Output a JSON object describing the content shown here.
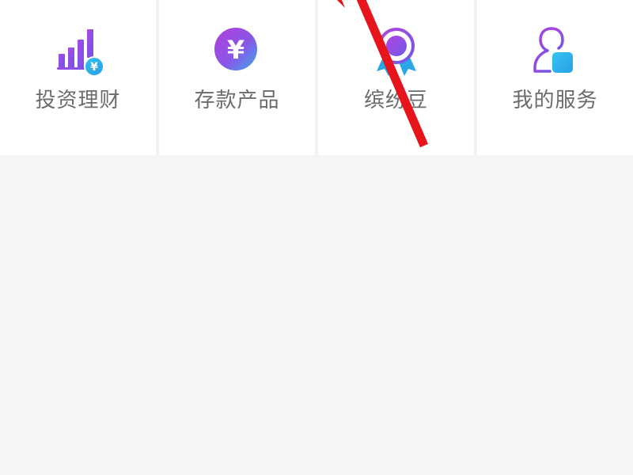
{
  "menu": {
    "tiles": [
      {
        "label": "投资理财",
        "icon": "bar-chart-yuan-icon"
      },
      {
        "label": "存款产品",
        "icon": "yuan-coin-icon"
      },
      {
        "label": "缤纷豆",
        "icon": "award-ribbon-icon"
      },
      {
        "label": "我的服务",
        "icon": "user-service-icon"
      }
    ]
  },
  "colors": {
    "accent_purple": "#9b3fe0",
    "accent_blue": "#2bb7ea",
    "ribbon_blue": "#28a6e6",
    "label_gray": "#6b6b6b",
    "background": "#f5f5f5",
    "annotation_red": "#e8141b"
  }
}
